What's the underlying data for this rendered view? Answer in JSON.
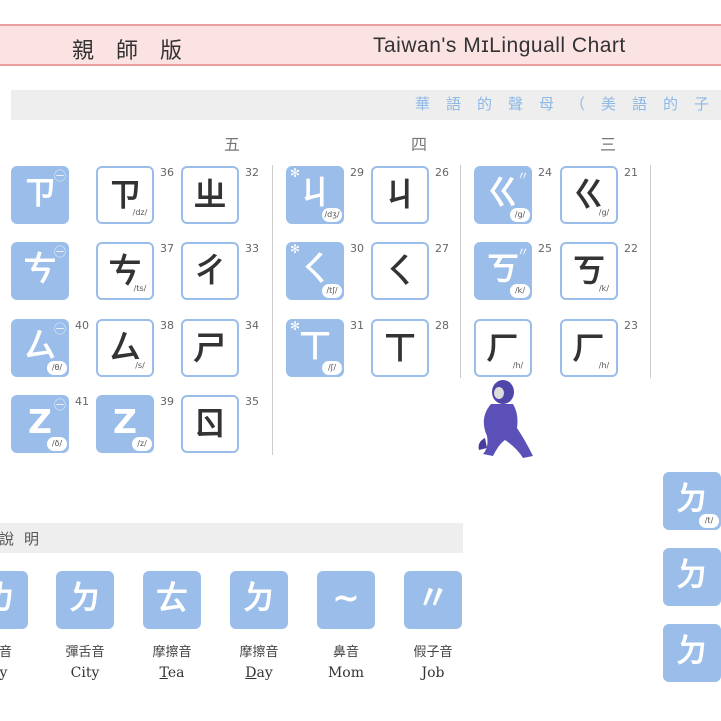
{
  "header": {
    "title_zh": "親師版",
    "title_en": "Taiwan's MɪLinguall Chart"
  },
  "subheader": {
    "text": "華語的聲母（美語的子音"
  },
  "columns": {
    "five": "五",
    "four": "四",
    "three": "三"
  },
  "tiles": [
    {
      "glyph": "ㄗ",
      "style": "solid",
      "ipa": "",
      "num": "",
      "mark": "㊀"
    },
    {
      "glyph": "ㄗ",
      "style": "outline",
      "ipa": "/dz/",
      "num": "36",
      "mark": ""
    },
    {
      "glyph": "ㄓ",
      "style": "outline",
      "ipa": "",
      "num": "32",
      "mark": ""
    },
    {
      "glyph": "ㄐ",
      "style": "solid",
      "ipa": "/dʒ/",
      "num": "29",
      "mark": "✻"
    },
    {
      "glyph": "ㄐ",
      "style": "outline",
      "ipa": "",
      "num": "26",
      "mark": ""
    },
    {
      "glyph": "ㄍ",
      "style": "solid",
      "ipa": "/g/",
      "num": "24",
      "mark": "〃"
    },
    {
      "glyph": "ㄍ",
      "style": "outline",
      "ipa": "/g/",
      "num": "21",
      "mark": ""
    },
    {
      "glyph": "ㄘ",
      "style": "solid",
      "ipa": "",
      "num": "",
      "mark": "㊀"
    },
    {
      "glyph": "ㄘ",
      "style": "outline",
      "ipa": "/ts/",
      "num": "37",
      "mark": ""
    },
    {
      "glyph": "ㄔ",
      "style": "outline",
      "ipa": "",
      "num": "33",
      "mark": ""
    },
    {
      "glyph": "ㄑ",
      "style": "solid",
      "ipa": "/tʃ/",
      "num": "30",
      "mark": "✻"
    },
    {
      "glyph": "ㄑ",
      "style": "outline",
      "ipa": "",
      "num": "27",
      "mark": ""
    },
    {
      "glyph": "ㄎ",
      "style": "solid",
      "ipa": "/k/",
      "num": "25",
      "mark": "〃"
    },
    {
      "glyph": "ㄎ",
      "style": "outline",
      "ipa": "/k/",
      "num": "22",
      "mark": ""
    },
    {
      "glyph": "ㄙ",
      "style": "solid",
      "ipa": "/θ/",
      "num": "40",
      "mark": "㊀"
    },
    {
      "glyph": "ㄙ",
      "style": "outline",
      "ipa": "/s/",
      "num": "38",
      "mark": ""
    },
    {
      "glyph": "ㄕ",
      "style": "outline",
      "ipa": "",
      "num": "34",
      "mark": ""
    },
    {
      "glyph": "ㄒ",
      "style": "solid",
      "ipa": "/ʃ/",
      "num": "31",
      "mark": "✻"
    },
    {
      "glyph": "ㄒ",
      "style": "outline",
      "ipa": "",
      "num": "28",
      "mark": ""
    },
    {
      "glyph": "ㄏ",
      "style": "outline",
      "ipa": "/h/",
      "num": "",
      "mark": ""
    },
    {
      "glyph": "ㄏ",
      "style": "outline",
      "ipa": "/h/",
      "num": "23",
      "mark": ""
    },
    {
      "glyph": "Z",
      "style": "solid",
      "ipa": "/ð/",
      "num": "41",
      "mark": "㊀"
    },
    {
      "glyph": "Z",
      "style": "solid",
      "ipa": "/z/",
      "num": "39",
      "mark": ""
    },
    {
      "glyph": "ㄖ",
      "style": "outline",
      "ipa": "",
      "num": "35",
      "mark": ""
    },
    {
      "glyph": "ㄉ",
      "style": "solid",
      "ipa": "/t/",
      "num": "",
      "mark": ""
    },
    {
      "glyph": "ㄉ",
      "style": "solid",
      "ipa": "",
      "num": "",
      "mark": ""
    },
    {
      "glyph": "ㄉ",
      "style": "solid",
      "ipa": "",
      "num": "",
      "mark": ""
    }
  ],
  "notes": {
    "title": "說明",
    "items": [
      {
        "glyph": "ㄌ",
        "label": "舌音",
        "word": "dy",
        "underline": ""
      },
      {
        "glyph": "ㄉ",
        "label": "彈舌音",
        "word": "City",
        "underline": ""
      },
      {
        "glyph": "ㄊ",
        "label": "摩擦音",
        "word": "ea",
        "underline": "T"
      },
      {
        "glyph": "ㄉ",
        "label": "摩擦音",
        "word": "ay",
        "underline": "D"
      },
      {
        "glyph": "~",
        "label": "鼻音",
        "word": "Mom",
        "underline": ""
      },
      {
        "glyph": "〃",
        "label": "假子音",
        "word": "Job",
        "underline": ""
      }
    ]
  }
}
